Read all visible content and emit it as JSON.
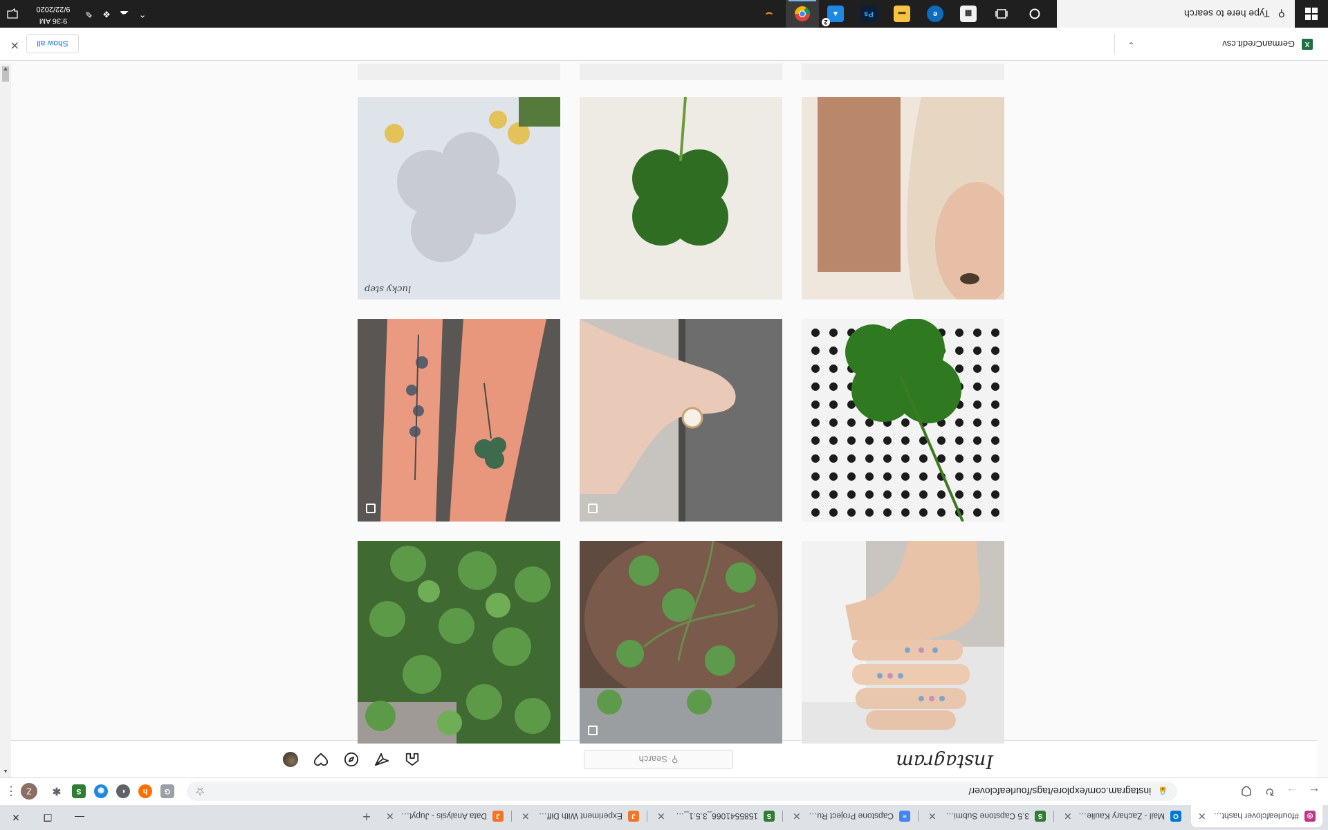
{
  "browser": {
    "tabs": [
      {
        "title": "#fourleafclover hashtag on Insta",
        "favicon": "instagram-icon",
        "color": "#c13584",
        "active": true
      },
      {
        "title": "Mail - Zachary Kaulie - Outlook",
        "favicon": "outlook-icon",
        "color": "#0078d4"
      },
      {
        "title": "3.5 Capstone Submission - Sprin",
        "favicon": "springboard-icon",
        "color": "#2e7d32"
      },
      {
        "title": "Capstone Project Rubric Data Co",
        "favicon": "docs-icon",
        "color": "#4285f4"
      },
      {
        "title": "1585541066_3.5.1_What_Data_to",
        "favicon": "springboard-icon",
        "color": "#2e7d32"
      },
      {
        "title": "Experiment With Different Mode",
        "favicon": "jupyter-icon",
        "color": "#f37626"
      },
      {
        "title": "Data Analysis - Jupyter Notebo",
        "favicon": "jupyter-icon",
        "color": "#f37626"
      }
    ],
    "new_tab": "+",
    "url": "instagram.com/explore/tags/fourleafclover/",
    "extensions": [
      "grammarly-icon",
      "honey-icon",
      "dark-reader-icon",
      "momentum-icon",
      "springboard-icon",
      "puzzle-icon"
    ],
    "profile_initial": "Z"
  },
  "instagram": {
    "logo": "Instagram",
    "search_placeholder": "Search",
    "posts": [
      {
        "subject": "hand with jewelry",
        "multi": false
      },
      {
        "subject": "clover plants in pot",
        "multi": true
      },
      {
        "subject": "clover patch",
        "multi": false
      },
      {
        "subject": "four leaf clover on polka dots",
        "multi": false
      },
      {
        "subject": "clover ring on hand",
        "multi": true
      },
      {
        "subject": "clover tattoo on arms",
        "multi": true
      },
      {
        "subject": "selfie with blonde hair",
        "multi": false
      },
      {
        "subject": "four leaf clover on white",
        "multi": false
      },
      {
        "subject": "glass clover with flowers",
        "multi": false,
        "caption": "lucky step"
      }
    ]
  },
  "downloads": {
    "file_name": "GermanCredit.csv",
    "show_all": "Show all"
  },
  "taskbar": {
    "search_placeholder": "Type here to search",
    "time": "9:36 AM",
    "date": "9/22/2020",
    "badge_count": "2"
  }
}
